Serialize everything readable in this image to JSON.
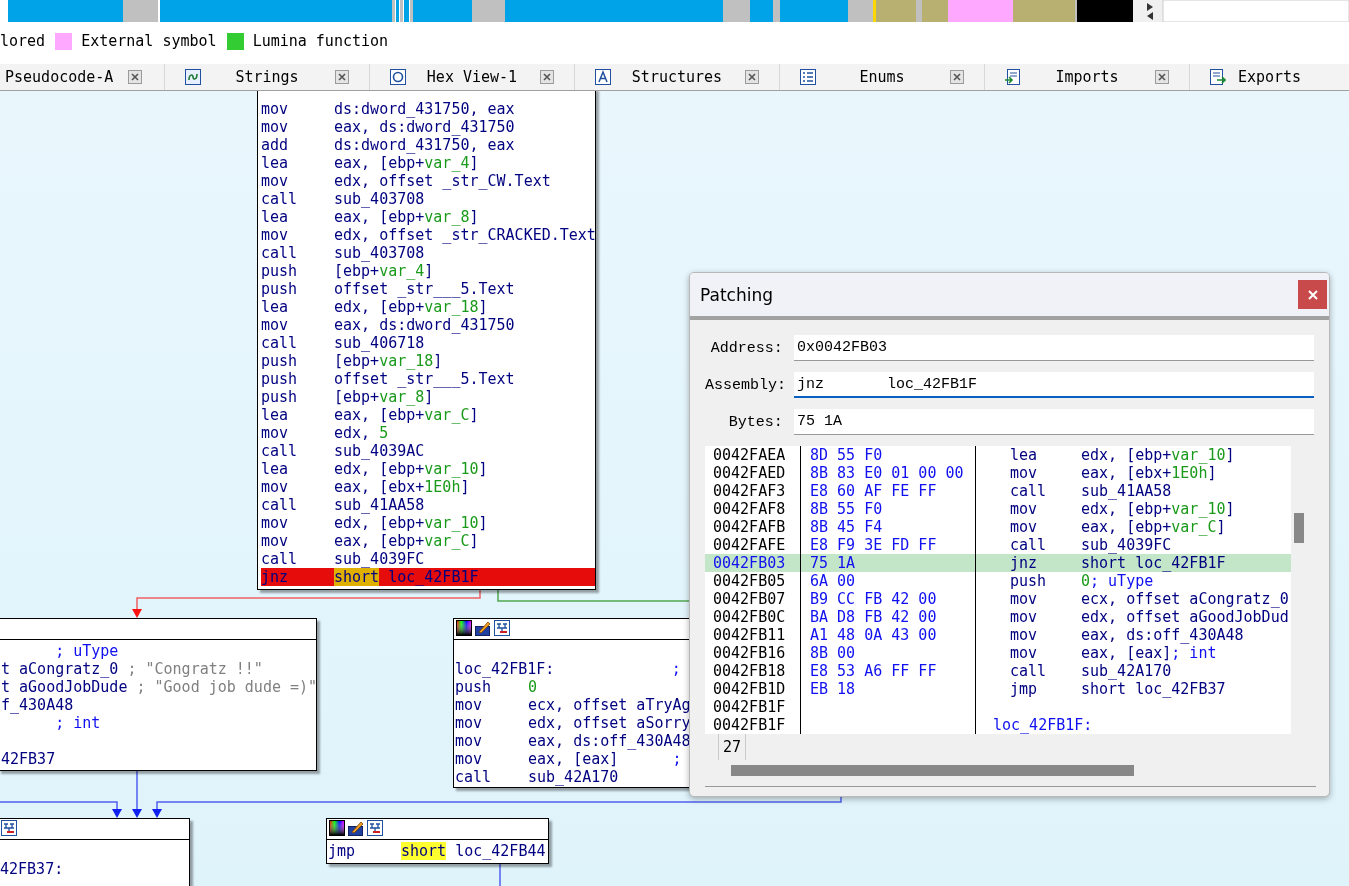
{
  "legend": [
    {
      "label": "lored"
    },
    {
      "label": "External symbol",
      "color": "#ffa8ff"
    },
    {
      "label": "Lumina function",
      "color": "#33cc33"
    }
  ],
  "tabs": [
    {
      "label": "Pseudocode-A",
      "kind": "pseudocode",
      "selected": false
    },
    {
      "label": "Strings",
      "kind": "strings",
      "selected": false
    },
    {
      "label": "Hex View-1",
      "kind": "hex",
      "selected": false
    },
    {
      "label": "Structures",
      "kind": "structures",
      "selected": false
    },
    {
      "label": "Enums",
      "kind": "enums",
      "selected": false
    },
    {
      "label": "Imports",
      "kind": "imports",
      "selected": false
    },
    {
      "label": "Exports",
      "kind": "exports",
      "selected": false
    }
  ],
  "graph": {
    "nodes": [
      {
        "lines": [
          {
            "mnemonic": "mov",
            "args": [
              {
                "text": "ds:dword_431750, eax",
                "kind": "plain"
              }
            ]
          },
          {
            "mnemonic": "mov",
            "args": [
              {
                "text": "eax, ds:dword_431750",
                "kind": "plain"
              }
            ]
          },
          {
            "mnemonic": "add",
            "args": [
              {
                "text": "ds:dword_431750, eax",
                "kind": "plain"
              }
            ]
          },
          {
            "mnemonic": "lea",
            "args": [
              {
                "text": "eax, [ebp+",
                "kind": "plain"
              },
              {
                "text": "var_4",
                "kind": "var"
              },
              {
                "text": "]",
                "kind": "plain"
              }
            ]
          },
          {
            "mnemonic": "mov",
            "args": [
              {
                "text": "edx, offset _str_CW.Text",
                "kind": "plain"
              }
            ]
          },
          {
            "mnemonic": "call",
            "args": [
              {
                "text": "sub_403708",
                "kind": "plain"
              }
            ]
          },
          {
            "mnemonic": "lea",
            "args": [
              {
                "text": "eax, [ebp+",
                "kind": "plain"
              },
              {
                "text": "var_8",
                "kind": "var"
              },
              {
                "text": "]",
                "kind": "plain"
              }
            ]
          },
          {
            "mnemonic": "mov",
            "args": [
              {
                "text": "edx, offset _str_CRACKED.Text",
                "kind": "plain"
              }
            ]
          },
          {
            "mnemonic": "call",
            "args": [
              {
                "text": "sub_403708",
                "kind": "plain"
              }
            ]
          },
          {
            "mnemonic": "push",
            "args": [
              {
                "text": "[ebp+",
                "kind": "plain"
              },
              {
                "text": "var_4",
                "kind": "var"
              },
              {
                "text": "]",
                "kind": "plain"
              }
            ]
          },
          {
            "mnemonic": "push",
            "args": [
              {
                "text": "offset _str___5.Text",
                "kind": "plain"
              }
            ]
          },
          {
            "mnemonic": "lea",
            "args": [
              {
                "text": "edx, [ebp+",
                "kind": "plain"
              },
              {
                "text": "var_18",
                "kind": "var"
              },
              {
                "text": "]",
                "kind": "plain"
              }
            ]
          },
          {
            "mnemonic": "mov",
            "args": [
              {
                "text": "eax, ds:dword_431750",
                "kind": "plain"
              }
            ]
          },
          {
            "mnemonic": "call",
            "args": [
              {
                "text": "sub_406718",
                "kind": "plain"
              }
            ]
          },
          {
            "mnemonic": "push",
            "args": [
              {
                "text": "[ebp+",
                "kind": "plain"
              },
              {
                "text": "var_18",
                "kind": "var"
              },
              {
                "text": "]",
                "kind": "plain"
              }
            ]
          },
          {
            "mnemonic": "push",
            "args": [
              {
                "text": "offset _str___5.Text",
                "kind": "plain"
              }
            ]
          },
          {
            "mnemonic": "push",
            "args": [
              {
                "text": "[ebp+",
                "kind": "plain"
              },
              {
                "text": "var_8",
                "kind": "var"
              },
              {
                "text": "]",
                "kind": "plain"
              }
            ]
          },
          {
            "mnemonic": "lea",
            "args": [
              {
                "text": "eax, [ebp+",
                "kind": "plain"
              },
              {
                "text": "var_C",
                "kind": "var"
              },
              {
                "text": "]",
                "kind": "plain"
              }
            ]
          },
          {
            "mnemonic": "mov",
            "args": [
              {
                "text": "edx, ",
                "kind": "plain"
              },
              {
                "text": "5",
                "kind": "num"
              }
            ]
          },
          {
            "mnemonic": "call",
            "args": [
              {
                "text": "sub_4039AC",
                "kind": "plain"
              }
            ]
          },
          {
            "mnemonic": "lea",
            "args": [
              {
                "text": "edx, [ebp+",
                "kind": "plain"
              },
              {
                "text": "var_10",
                "kind": "var"
              },
              {
                "text": "]",
                "kind": "plain"
              }
            ]
          },
          {
            "mnemonic": "mov",
            "args": [
              {
                "text": "eax, [ebx+",
                "kind": "plain"
              },
              {
                "text": "1E0h",
                "kind": "num"
              },
              {
                "text": "]",
                "kind": "plain"
              }
            ]
          },
          {
            "mnemonic": "call",
            "args": [
              {
                "text": "sub_41AA58",
                "kind": "plain"
              }
            ]
          },
          {
            "mnemonic": "mov",
            "args": [
              {
                "text": "edx, [ebp+",
                "kind": "plain"
              },
              {
                "text": "var_10",
                "kind": "var"
              },
              {
                "text": "]",
                "kind": "plain"
              }
            ]
          },
          {
            "mnemonic": "mov",
            "args": [
              {
                "text": "eax, [ebp+",
                "kind": "plain"
              },
              {
                "text": "var_C",
                "kind": "var"
              },
              {
                "text": "]",
                "kind": "plain"
              }
            ]
          },
          {
            "mnemonic": "call",
            "args": [
              {
                "text": "sub_4039FC",
                "kind": "plain"
              }
            ]
          }
        ],
        "branch_line": {
          "mnemonic": "jnz",
          "breakpoint": true,
          "args": [
            {
              "text": "short",
              "kind": "hl"
            },
            {
              "text": " loc_42FB1F",
              "kind": "plain"
            }
          ]
        }
      },
      {
        "lines": [
          {
            "args": [
              {
                "text": "      ; uType",
                "kind": "comment"
              }
            ]
          },
          {
            "args": [
              {
                "text": "t aCongratz_0 ",
                "kind": "plain"
              },
              {
                "text": "; \"Congratz !!\"",
                "kind": "string"
              }
            ]
          },
          {
            "args": [
              {
                "text": "t aGoodJobDude ",
                "kind": "plain"
              },
              {
                "text": "; \"Good job dude =)\"",
                "kind": "string"
              }
            ]
          },
          {
            "args": [
              {
                "text": "f_430A48",
                "kind": "plain"
              }
            ]
          },
          {
            "args": [
              {
                "text": "      ; int",
                "kind": "comment"
              }
            ]
          },
          {
            "kind": "blank"
          },
          {
            "args": [
              {
                "text": "42FB37",
                "kind": "plain"
              }
            ]
          }
        ]
      },
      {
        "lines": [
          {
            "kind": "blank"
          },
          {
            "args": [
              {
                "text": "loc_42FB1F:",
                "kind": "label"
              },
              {
                "text": "             ;",
                "kind": "comment"
              }
            ]
          },
          {
            "mnemonic": "push",
            "args": [
              {
                "text": "0",
                "kind": "num"
              }
            ]
          },
          {
            "mnemonic": "mov",
            "args": [
              {
                "text": "ecx, offset aTryAg",
                "kind": "plain"
              }
            ]
          },
          {
            "mnemonic": "mov",
            "args": [
              {
                "text": "edx, offset aSorry",
                "kind": "plain"
              }
            ]
          },
          {
            "mnemonic": "mov",
            "args": [
              {
                "text": "eax, ds:off_430A48",
                "kind": "plain"
              }
            ]
          },
          {
            "mnemonic": "mov",
            "args": [
              {
                "text": "eax, [eax]",
                "kind": "plain"
              },
              {
                "text": "      ;",
                "kind": "comment"
              }
            ]
          },
          {
            "mnemonic": "call",
            "args": [
              {
                "text": "sub_42A170",
                "kind": "plain"
              }
            ]
          }
        ]
      },
      {
        "lines": [
          {
            "mnemonic": "jmp",
            "args": [
              {
                "text": "short",
                "kind": "hl"
              },
              {
                "text": " loc_42FB44",
                "kind": "plain"
              }
            ]
          }
        ]
      },
      {
        "lines": [
          {
            "kind": "blank"
          },
          {
            "args": [
              {
                "text": "42FB37:",
                "kind": "label"
              }
            ]
          }
        ]
      }
    ]
  },
  "patching": {
    "title": "Patching",
    "fields": [
      {
        "label": "Address:",
        "value": "0x0042FB03",
        "focused": false
      },
      {
        "label": "Assembly:",
        "value": "jnz       loc_42FB1F",
        "focused": true
      },
      {
        "label": "Bytes:",
        "value": "75 1A",
        "focused": false
      }
    ],
    "listing": [
      {
        "address": "0042FAEA",
        "bytes": "8D 55 F0",
        "selected": false,
        "instruction": {
          "mnemonic": "lea",
          "args": [
            {
              "text": "edx, [ebp+",
              "kind": "plain"
            },
            {
              "text": "var_10",
              "kind": "var"
            },
            {
              "text": "]",
              "kind": "plain"
            }
          ]
        }
      },
      {
        "address": "0042FAED",
        "bytes": "8B 83 E0 01 00 00",
        "selected": false,
        "instruction": {
          "mnemonic": "mov",
          "args": [
            {
              "text": "eax, [ebx+",
              "kind": "plain"
            },
            {
              "text": "1E0h",
              "kind": "num"
            },
            {
              "text": "]",
              "kind": "plain"
            }
          ]
        }
      },
      {
        "address": "0042FAF3",
        "bytes": "E8 60 AF FE FF",
        "selected": false,
        "instruction": {
          "mnemonic": "call",
          "args": [
            {
              "text": "sub_41AA58",
              "kind": "plain"
            }
          ]
        }
      },
      {
        "address": "0042FAF8",
        "bytes": "8B 55 F0",
        "selected": false,
        "instruction": {
          "mnemonic": "mov",
          "args": [
            {
              "text": "edx, [ebp+",
              "kind": "plain"
            },
            {
              "text": "var_10",
              "kind": "var"
            },
            {
              "text": "]",
              "kind": "plain"
            }
          ]
        }
      },
      {
        "address": "0042FAFB",
        "bytes": "8B 45 F4",
        "selected": false,
        "instruction": {
          "mnemonic": "mov",
          "args": [
            {
              "text": "eax, [ebp+",
              "kind": "plain"
            },
            {
              "text": "var_C",
              "kind": "var"
            },
            {
              "text": "]",
              "kind": "plain"
            }
          ]
        }
      },
      {
        "address": "0042FAFE",
        "bytes": "E8 F9 3E FD FF",
        "selected": false,
        "instruction": {
          "mnemonic": "call",
          "args": [
            {
              "text": "sub_4039FC",
              "kind": "plain"
            }
          ]
        }
      },
      {
        "address": "0042FB03",
        "bytes": "75 1A",
        "selected": true,
        "instruction": {
          "mnemonic": "jnz",
          "args": [
            {
              "text": "short loc_42FB1F",
              "kind": "plain"
            }
          ]
        }
      },
      {
        "address": "0042FB05",
        "bytes": "6A 00",
        "selected": false,
        "instruction": {
          "mnemonic": "push",
          "args": [
            {
              "text": "0",
              "kind": "num"
            },
            {
              "text": "; uType",
              "kind": "comment"
            }
          ]
        }
      },
      {
        "address": "0042FB07",
        "bytes": "B9 CC FB 42 00",
        "selected": false,
        "instruction": {
          "mnemonic": "mov",
          "args": [
            {
              "text": "ecx, offset aCongratz_0",
              "kind": "plain"
            }
          ]
        }
      },
      {
        "address": "0042FB0C",
        "bytes": "BA D8 FB 42 00",
        "selected": false,
        "instruction": {
          "mnemonic": "mov",
          "args": [
            {
              "text": "edx, offset aGoodJobDud",
              "kind": "plain"
            }
          ]
        }
      },
      {
        "address": "0042FB11",
        "bytes": "A1 48 0A 43 00",
        "selected": false,
        "instruction": {
          "mnemonic": "mov",
          "args": [
            {
              "text": "eax, ds:off_430A48",
              "kind": "plain"
            }
          ]
        }
      },
      {
        "address": "0042FB16",
        "bytes": "8B 00",
        "selected": false,
        "instruction": {
          "mnemonic": "mov",
          "args": [
            {
              "text": "eax, [eax]",
              "kind": "plain"
            },
            {
              "text": "; int",
              "kind": "comment"
            }
          ]
        }
      },
      {
        "address": "0042FB18",
        "bytes": "E8 53 A6 FF FF",
        "selected": false,
        "instruction": {
          "mnemonic": "call",
          "args": [
            {
              "text": "sub_42A170",
              "kind": "plain"
            }
          ]
        }
      },
      {
        "address": "0042FB1D",
        "bytes": "EB 18",
        "selected": false,
        "instruction": {
          "mnemonic": "jmp",
          "args": [
            {
              "text": "short loc_42FB37",
              "kind": "plain"
            }
          ]
        }
      },
      {
        "address": "0042FB1F",
        "selected": false
      },
      {
        "address": "0042FB1F",
        "selected": false,
        "instruction": {
          "args": [
            {
              "text": "loc_42FB1F:",
              "kind": "label"
            }
          ]
        }
      }
    ],
    "status_cell": "27"
  }
}
